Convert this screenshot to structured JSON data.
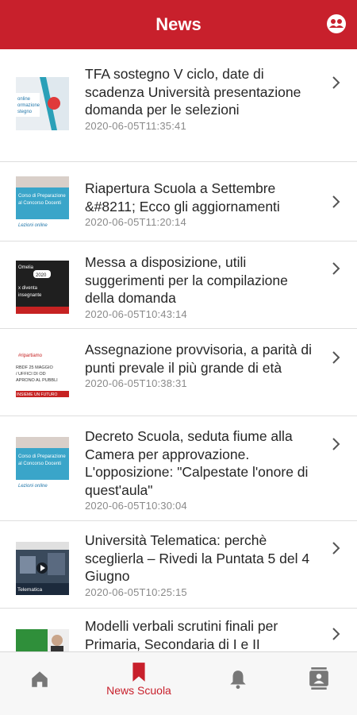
{
  "header": {
    "title": "News",
    "action_icon": "contacts-round-icon"
  },
  "colors": {
    "brand": "#c8202c",
    "text": "#262626",
    "date": "#8a8a8a",
    "tab_inactive": "#777777"
  },
  "articles": [
    {
      "title": "TFA sostegno V ciclo, date di scadenza Università presentazione domanda per le selezioni",
      "date": "2020-06-05T11:35:41",
      "thumb_text": [
        "online",
        "ormazione",
        "stegno"
      ]
    },
    {
      "title": "Riapertura Scuola a Settembre &#8211; Ecco gli aggiornamenti",
      "date": "2020-06-05T11:20:14",
      "thumb_text": [
        "Corso di Preparazione",
        "al Concorso Docenti",
        "Lezioni online"
      ]
    },
    {
      "title": "Messa a disposizione, utili suggerimenti per la compilazione della domanda",
      "date": "2020-06-05T10:43:14",
      "thumb_text": [
        "Omelia",
        "2020",
        "x diventa",
        "insegnante"
      ]
    },
    {
      "title": "Assegnazione provvisoria, a parità di punti prevale il più grande di età",
      "date": "2020-06-05T10:38:31",
      "thumb_text": [
        "#ripartiamo",
        "RBDF 25 MAGGIO",
        "/ UFFICI DI OD",
        "APRONO AL PUBBLI",
        "INSIEME UN FUTURO"
      ]
    },
    {
      "title": "Decreto Scuola, seduta fiume alla Camera per approvazione. L'opposizione: \"Calpestate l'onore di quest'aula\"",
      "date": "2020-06-05T10:30:04",
      "thumb_text": [
        "Corso di Preparazione",
        "al Concorso Docenti",
        "Lezioni online"
      ]
    },
    {
      "title": "Università Telematica: perchè sceglierla – Rivedi la Puntata 5 del 4 Giugno",
      "date": "2020-06-05T10:25:15",
      "thumb_text": [
        "Telematica"
      ]
    },
    {
      "title": "Modelli verbali scrutini finali per Primaria, Secondaria di I e II",
      "date": "",
      "thumb_text": []
    }
  ],
  "tabs": [
    {
      "id": "home",
      "label": "",
      "icon": "home-icon",
      "active": false
    },
    {
      "id": "news",
      "label": "News Scuola",
      "icon": "bookmark-icon",
      "active": true
    },
    {
      "id": "notifications",
      "label": "",
      "icon": "bell-icon",
      "active": false
    },
    {
      "id": "contacts",
      "label": "",
      "icon": "contacts-book-icon",
      "active": false
    }
  ]
}
